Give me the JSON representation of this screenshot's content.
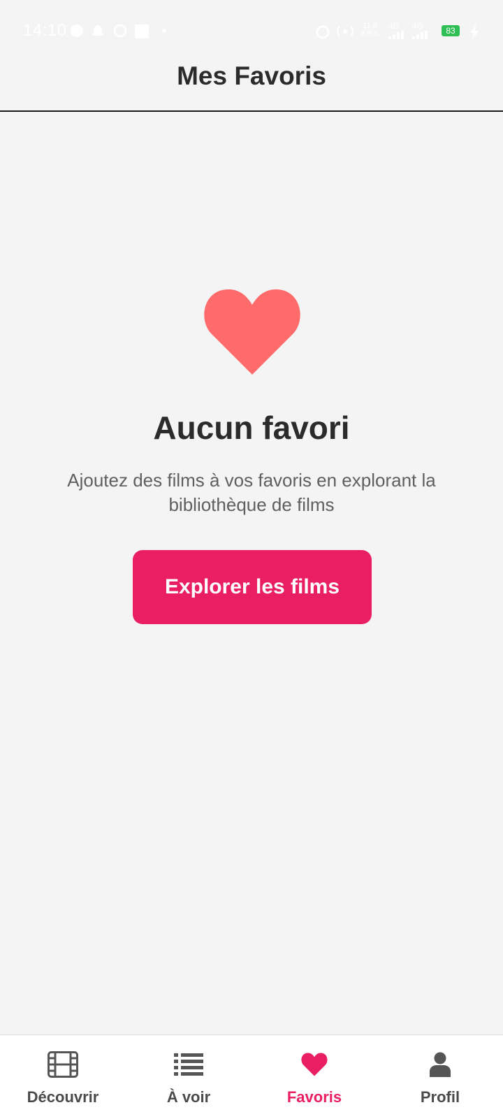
{
  "status_bar": {
    "time": "14:10",
    "network_speed": "11,8",
    "network_speed_unit": "KB/S",
    "signal_1": "4G",
    "signal_2": "4G",
    "battery": "83"
  },
  "header": {
    "title": "Mes Favoris"
  },
  "empty_state": {
    "icon": "heart-icon",
    "title": "Aucun favori",
    "description": "Ajoutez des films à vos favoris en explorant la bibliothèque de films",
    "button_label": "Explorer les films"
  },
  "bottom_nav": {
    "items": [
      {
        "label": "Découvrir",
        "icon": "film-icon",
        "active": false
      },
      {
        "label": "À voir",
        "icon": "list-icon",
        "active": false
      },
      {
        "label": "Favoris",
        "icon": "heart-icon",
        "active": true
      },
      {
        "label": "Profil",
        "icon": "user-icon",
        "active": false
      }
    ]
  },
  "colors": {
    "accent": "#e91e63",
    "heart_hero": "#ff6b6b",
    "background": "#f4f4f4",
    "text": "#2b2b2b"
  }
}
